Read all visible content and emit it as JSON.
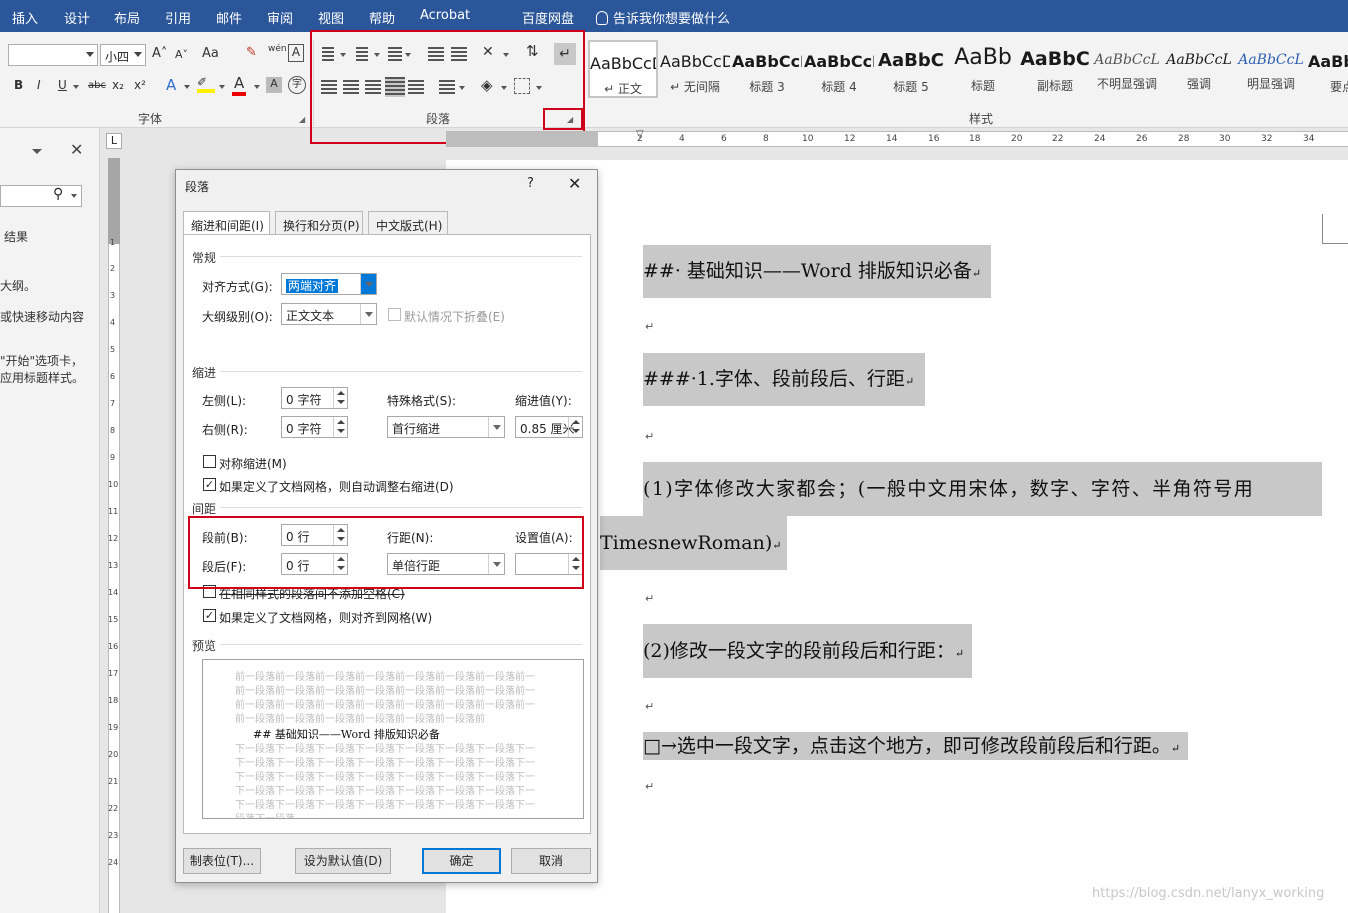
{
  "menubar": {
    "items": [
      "插入",
      "设计",
      "布局",
      "引用",
      "邮件",
      "审阅",
      "视图",
      "帮助",
      "Acrobat",
      "百度网盘"
    ],
    "tell_me": "告诉我你想要做什么"
  },
  "ribbon": {
    "font": {
      "label": "字体",
      "font_name": "",
      "font_size": "小四",
      "buttons": [
        "B",
        "I",
        "U",
        "abc",
        "x₂",
        "x²",
        "A",
        "A"
      ],
      "grow": "A˄",
      "shrink": "A˅",
      "case": "Aa",
      "wen": "wén",
      "border_a": "A",
      "circle": "字"
    },
    "paragraph": {
      "label": "段落"
    },
    "styles": {
      "label": "样式",
      "items": [
        {
          "sample": "AaBbCcD",
          "name": "↵ 正文"
        },
        {
          "sample": "AaBbCcD",
          "name": "↵ 无间隔"
        },
        {
          "sample": "AaBbCcI",
          "name": "标题 3"
        },
        {
          "sample": "AaBbCcD",
          "name": "标题 4"
        },
        {
          "sample": "AaBbC",
          "name": "标题 5"
        },
        {
          "sample": "AaBb",
          "name": "标题"
        },
        {
          "sample": "AaBbC",
          "name": "副标题"
        },
        {
          "sample": "AaBbCcL",
          "name": "不明显强调"
        },
        {
          "sample": "AaBbCcL",
          "name": "强调"
        },
        {
          "sample": "AaBbCcL",
          "name": "明显强调"
        },
        {
          "sample": "AaBb",
          "name": "要点"
        }
      ]
    }
  },
  "navpane": {
    "results": "结果",
    "line1": "大纲。",
    "line2": "或快速移动内容",
    "line3": "\"开始\"选项卡，",
    "line4": "应用标题样式。"
  },
  "ruler": {
    "h_ticks": [
      "2",
      "4",
      "6",
      "8",
      "10",
      "12",
      "14",
      "16",
      "18",
      "20",
      "22",
      "24",
      "26",
      "28",
      "30",
      "32",
      "34"
    ],
    "v_ticks": [
      "1",
      "2",
      "3",
      "4",
      "5",
      "6",
      "7",
      "8",
      "9",
      "10",
      "11",
      "12",
      "13",
      "14",
      "15",
      "16",
      "17",
      "18",
      "19",
      "20",
      "21",
      "22",
      "23",
      "24"
    ],
    "tab_selector": "L"
  },
  "document": {
    "p1": "##· 基础知识——Word 排版知识必备",
    "p2": "###·1.字体、段前段后、行距",
    "p3a": "(1)字体修改大家都会；(一般中文用宋体，数字、字符、半角符号用",
    "p3b": "TimesnewRoman)",
    "p4": "(2)修改一段文字的段前段后和行距：",
    "p5": "□→选中一段文字，点击这个地方，即可修改段前段后和行距。",
    "mark": "↵"
  },
  "watermark": "https://blog.csdn.net/lanyx_working",
  "dialog": {
    "title": "段落",
    "help": "?",
    "close": "✕",
    "tabs": [
      "缩进和间距(I)",
      "换行和分页(P)",
      "中文版式(H)"
    ],
    "general": {
      "section": "常规",
      "alignment_label": "对齐方式(G):",
      "alignment_value": "两端对齐",
      "outline_label": "大纲级别(O):",
      "outline_value": "正文文本",
      "collapse_label": "默认情况下折叠(E)"
    },
    "indent": {
      "section": "缩进",
      "left_label": "左侧(L):",
      "left_value": "0 字符",
      "right_label": "右侧(R):",
      "right_value": "0 字符",
      "special_label": "特殊格式(S):",
      "special_value": "首行缩进",
      "by_label": "缩进值(Y):",
      "by_value": "0.85 厘米",
      "mirror_label": "对称缩进(M)",
      "auto_adjust_label": "如果定义了文档网格，则自动调整右缩进(D)"
    },
    "spacing": {
      "section": "间距",
      "before_label": "段前(B):",
      "before_value": "0 行",
      "after_label": "段后(F):",
      "after_value": "0 行",
      "line_label": "行距(N):",
      "line_value": "单倍行距",
      "at_label": "设置值(A):",
      "at_value": "",
      "no_space_label": "在相同样式的段落间不添加空格(C)",
      "snap_label": "如果定义了文档网格，则对齐到网格(W)"
    },
    "preview": {
      "section": "预览",
      "prev_text": "前一段落前一段落前一段落前一段落前一段落前一段落前一段落前一段落前一段落前一段落前一段落前一段落",
      "title_text": "## 基础知识——Word 排版知识必备",
      "next_text": "下一段落下一段落下一段落下一段落下一段落下一段落下一段落下一段落下一段落下一段落下一段落下一段落",
      "last_text": "段落下一段落"
    },
    "buttons": {
      "tabs": "制表位(T)...",
      "default": "设为默认值(D)",
      "ok": "确定",
      "cancel": "取消"
    }
  }
}
